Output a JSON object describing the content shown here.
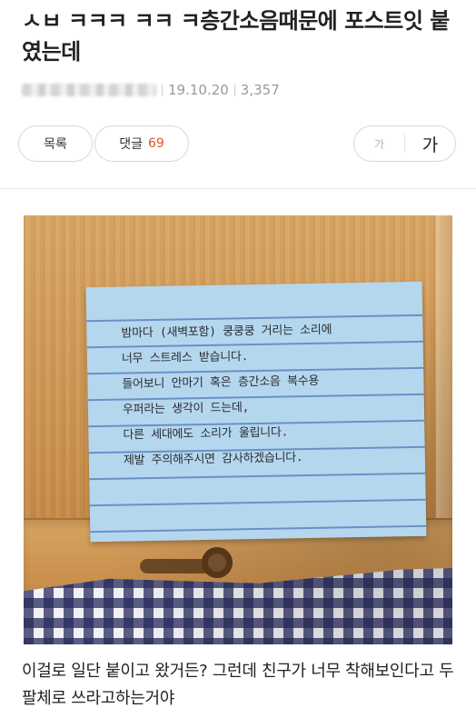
{
  "post": {
    "title": "ㅅㅂ ㅋㅋㅋ ㅋㅋ ㅋ층간소음때문에 포스트잇 붙였는데",
    "date": "19.10.20",
    "views": "3,357"
  },
  "actions": {
    "list_label": "목록",
    "comment_label": "댓글",
    "comment_count": "69",
    "font_small": "가",
    "font_large": "가"
  },
  "note": {
    "lines": [
      "밤마다 (새벽포함) 쿵쿵쿵 거리는 소리에",
      "너무 스트레스 받습니다.",
      "들어보니 안마기 혹은 층간소음 복수용",
      "우퍼라는 생각이 드는데,",
      "다른 세대에도 소리가 울립니다.",
      "제발 주의해주시면 감사하겠습니다."
    ]
  },
  "body": {
    "text": "이걸로 일단 붙이고 왔거든? 그런데 친구가 너무 착해보인다고 두팔체로 쓰라고하는거야"
  }
}
